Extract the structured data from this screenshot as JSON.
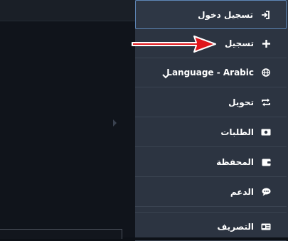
{
  "sidebar": {
    "items": [
      {
        "label": "تسجيل دخول",
        "icon": "sign-in-icon"
      },
      {
        "label": "تسجيل",
        "icon": "plus-icon"
      },
      {
        "label": "Language - Arabic",
        "icon": "globe-icon"
      },
      {
        "label": "تحويل",
        "icon": "transfer-icon"
      },
      {
        "label": "الطلبات",
        "icon": "money-bill-icon"
      },
      {
        "label": "المحفظة",
        "icon": "wallet-icon"
      },
      {
        "label": "الدعم",
        "icon": "chat-bubble-icon"
      },
      {
        "label": "التصريف",
        "icon": "id-card-icon"
      }
    ]
  },
  "annotation": {
    "icon": "red-arrow-icon",
    "color": "#e0161b"
  },
  "colors": {
    "sidebar_bg": "#2c3441",
    "active_border": "#5e86b6",
    "text": "#ffffff"
  }
}
